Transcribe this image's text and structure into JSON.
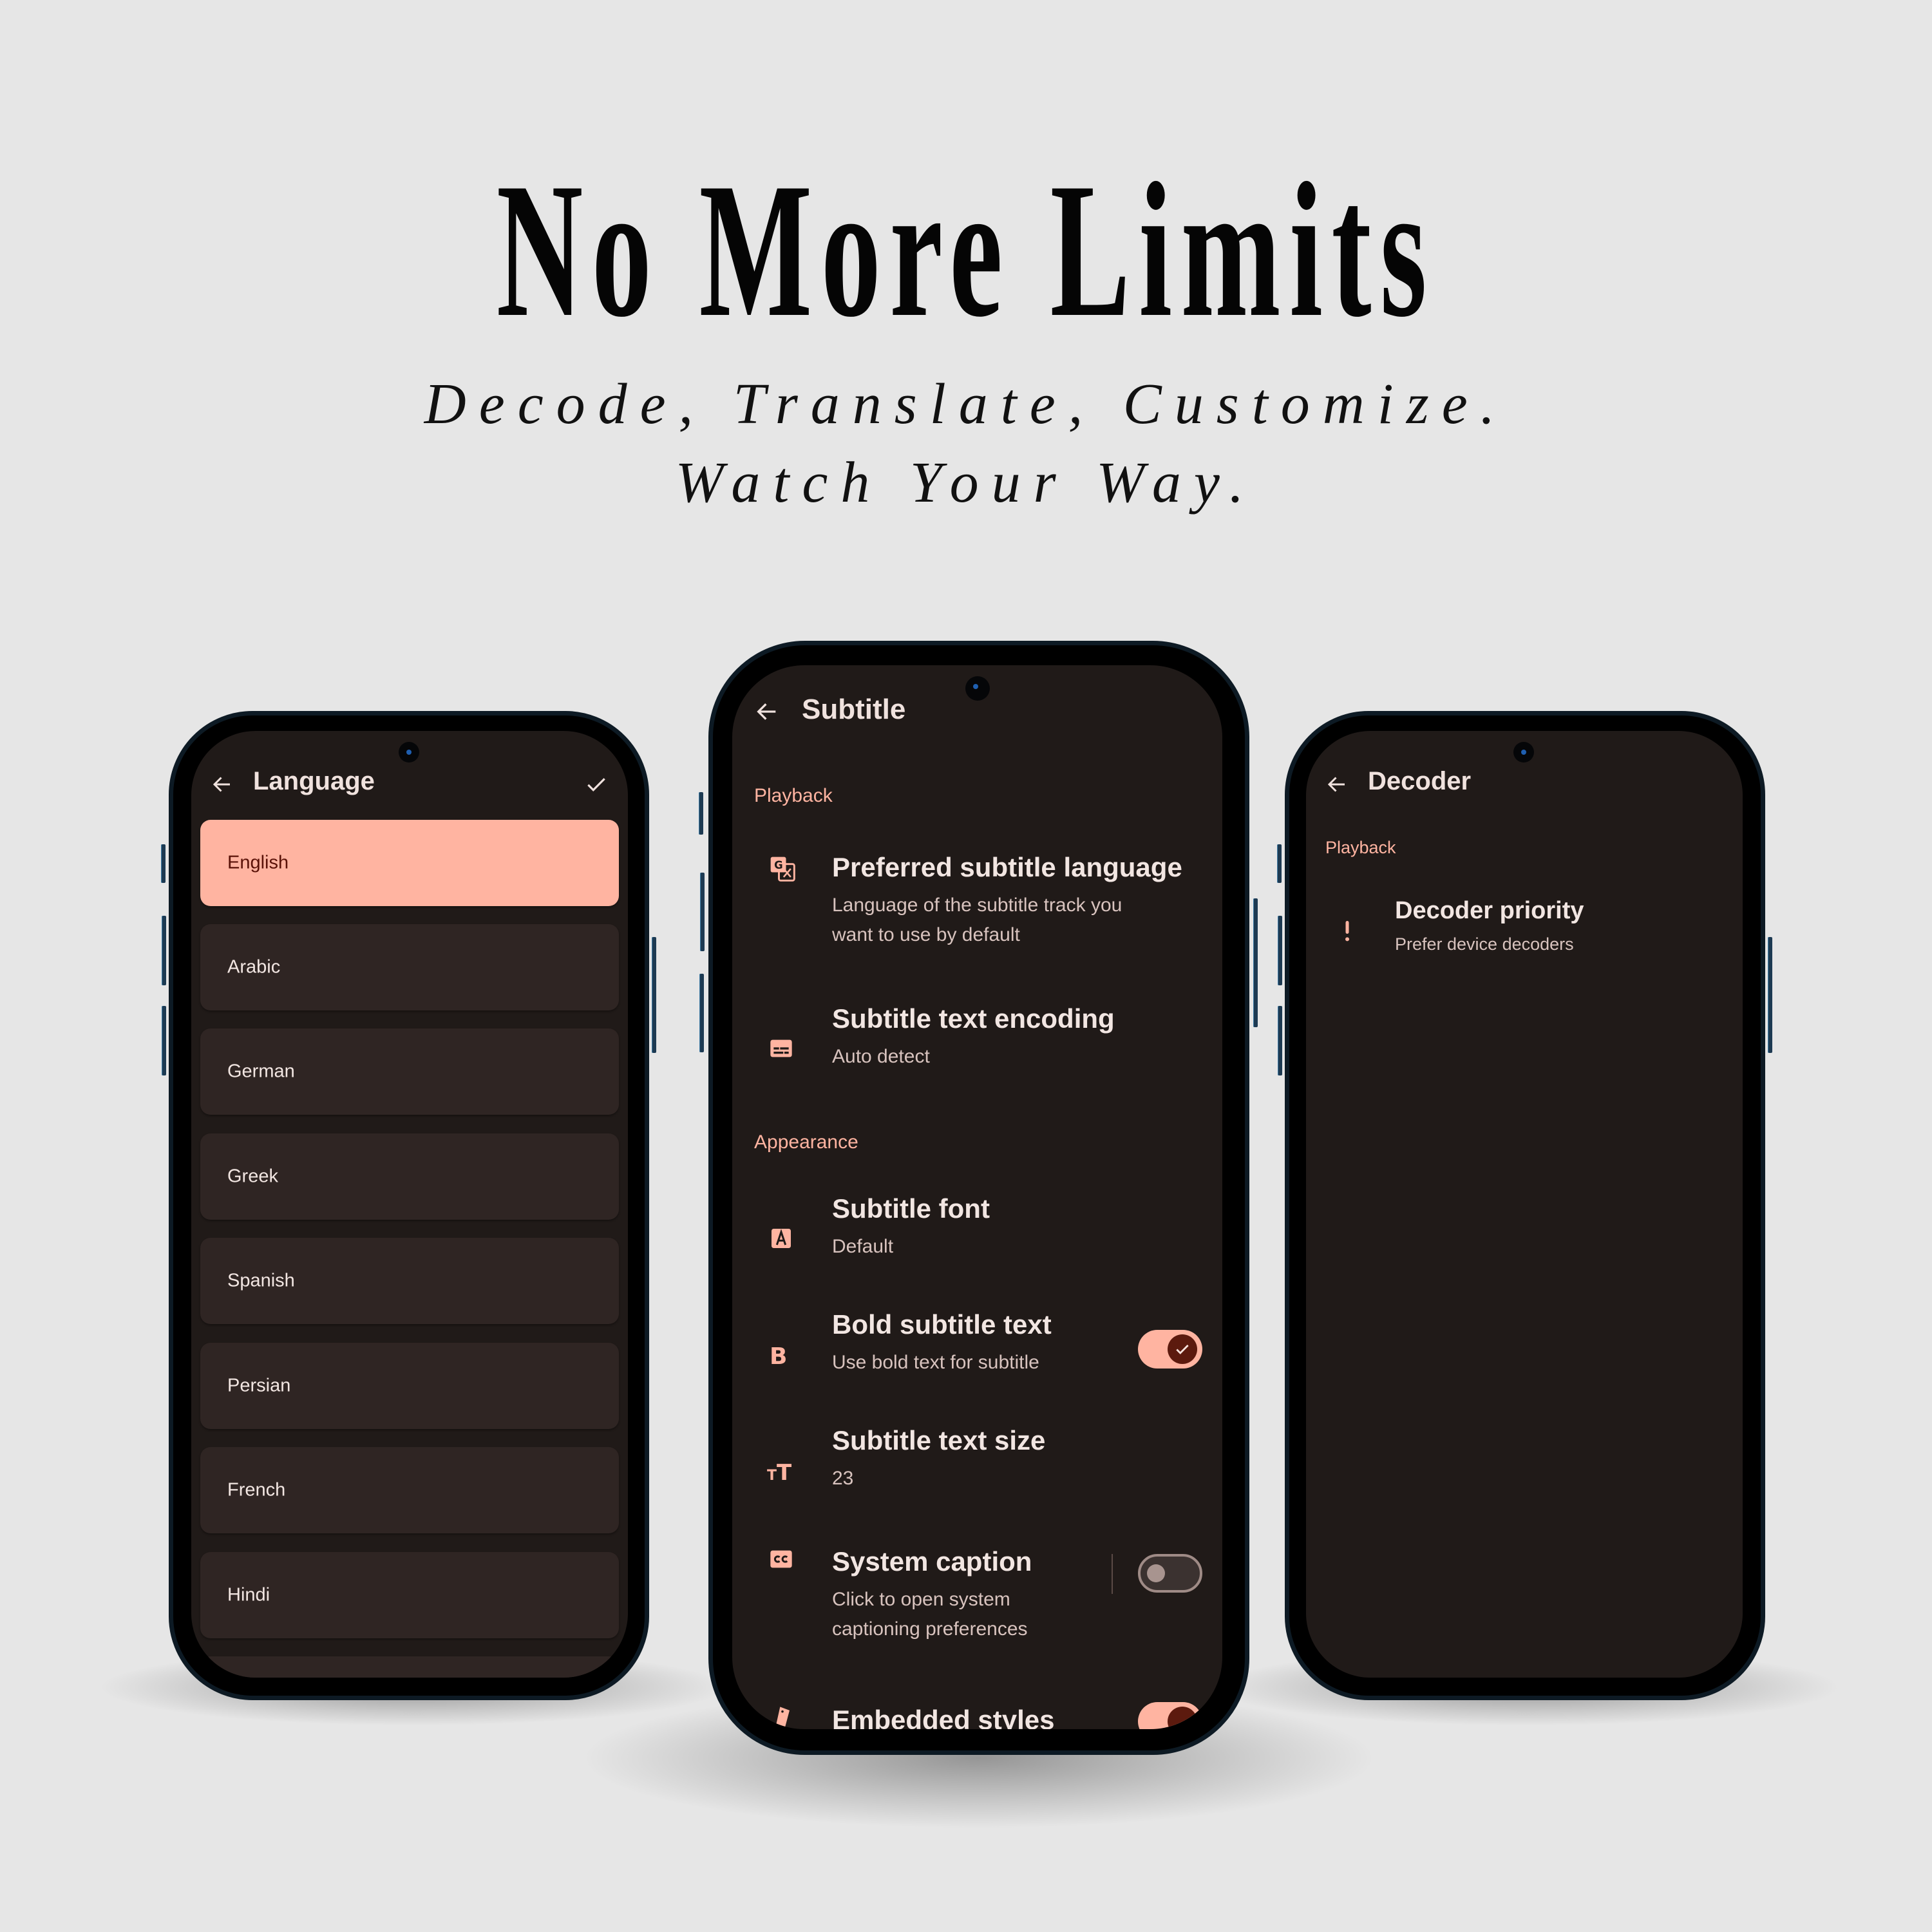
{
  "hero": {
    "headline": "No More Limits",
    "tagline_line1": "Decode, Translate, Customize.",
    "tagline_line2": "Watch Your Way."
  },
  "theme": {
    "accent": "#ffb4a1",
    "screen_background": "#201a18",
    "card_background": "#2f2523",
    "toggle_knob_on": "#5c1a0e"
  },
  "language_screen": {
    "title": "Language",
    "back_icon": "arrow-left-icon",
    "confirm_icon": "check-icon",
    "items": [
      {
        "label": "English",
        "selected": true
      },
      {
        "label": "Arabic",
        "selected": false
      },
      {
        "label": "German",
        "selected": false
      },
      {
        "label": "Greek",
        "selected": false
      },
      {
        "label": "Spanish",
        "selected": false
      },
      {
        "label": "Persian",
        "selected": false
      },
      {
        "label": "French",
        "selected": false
      },
      {
        "label": "Hindi",
        "selected": false
      }
    ]
  },
  "subtitle_screen": {
    "title": "Subtitle",
    "back_icon": "arrow-left-icon",
    "sections": [
      {
        "label": "Playback",
        "items": [
          {
            "icon": "translate-icon",
            "title": "Preferred subtitle language",
            "subtitle_line1": "Language of the subtitle track you",
            "subtitle_line2": "want to use by default"
          },
          {
            "icon": "subtitles-icon",
            "title": "Subtitle text encoding",
            "subtitle_line1": "Auto detect"
          }
        ]
      },
      {
        "label": "Appearance",
        "items": [
          {
            "icon": "font-icon",
            "title": "Subtitle font",
            "subtitle_line1": "Default"
          },
          {
            "icon": "bold-icon",
            "title": "Bold subtitle text",
            "subtitle_line1": "Use bold text for subtitle",
            "toggle": true
          },
          {
            "icon": "text-size-icon",
            "title": "Subtitle text size",
            "subtitle_line1": "23"
          },
          {
            "icon": "closed-caption-icon",
            "title": "System caption",
            "subtitle_line1": "Click to open system",
            "subtitle_line2": "captioning preferences",
            "toggle": false
          },
          {
            "icon": "embedded-styles-icon",
            "title": "Embedded styles",
            "toggle": true
          }
        ]
      }
    ]
  },
  "decoder_screen": {
    "title": "Decoder",
    "back_icon": "arrow-left-icon",
    "section_label": "Playback",
    "items": [
      {
        "icon": "priority-icon",
        "title": "Decoder priority",
        "subtitle": "Prefer device decoders"
      }
    ]
  }
}
